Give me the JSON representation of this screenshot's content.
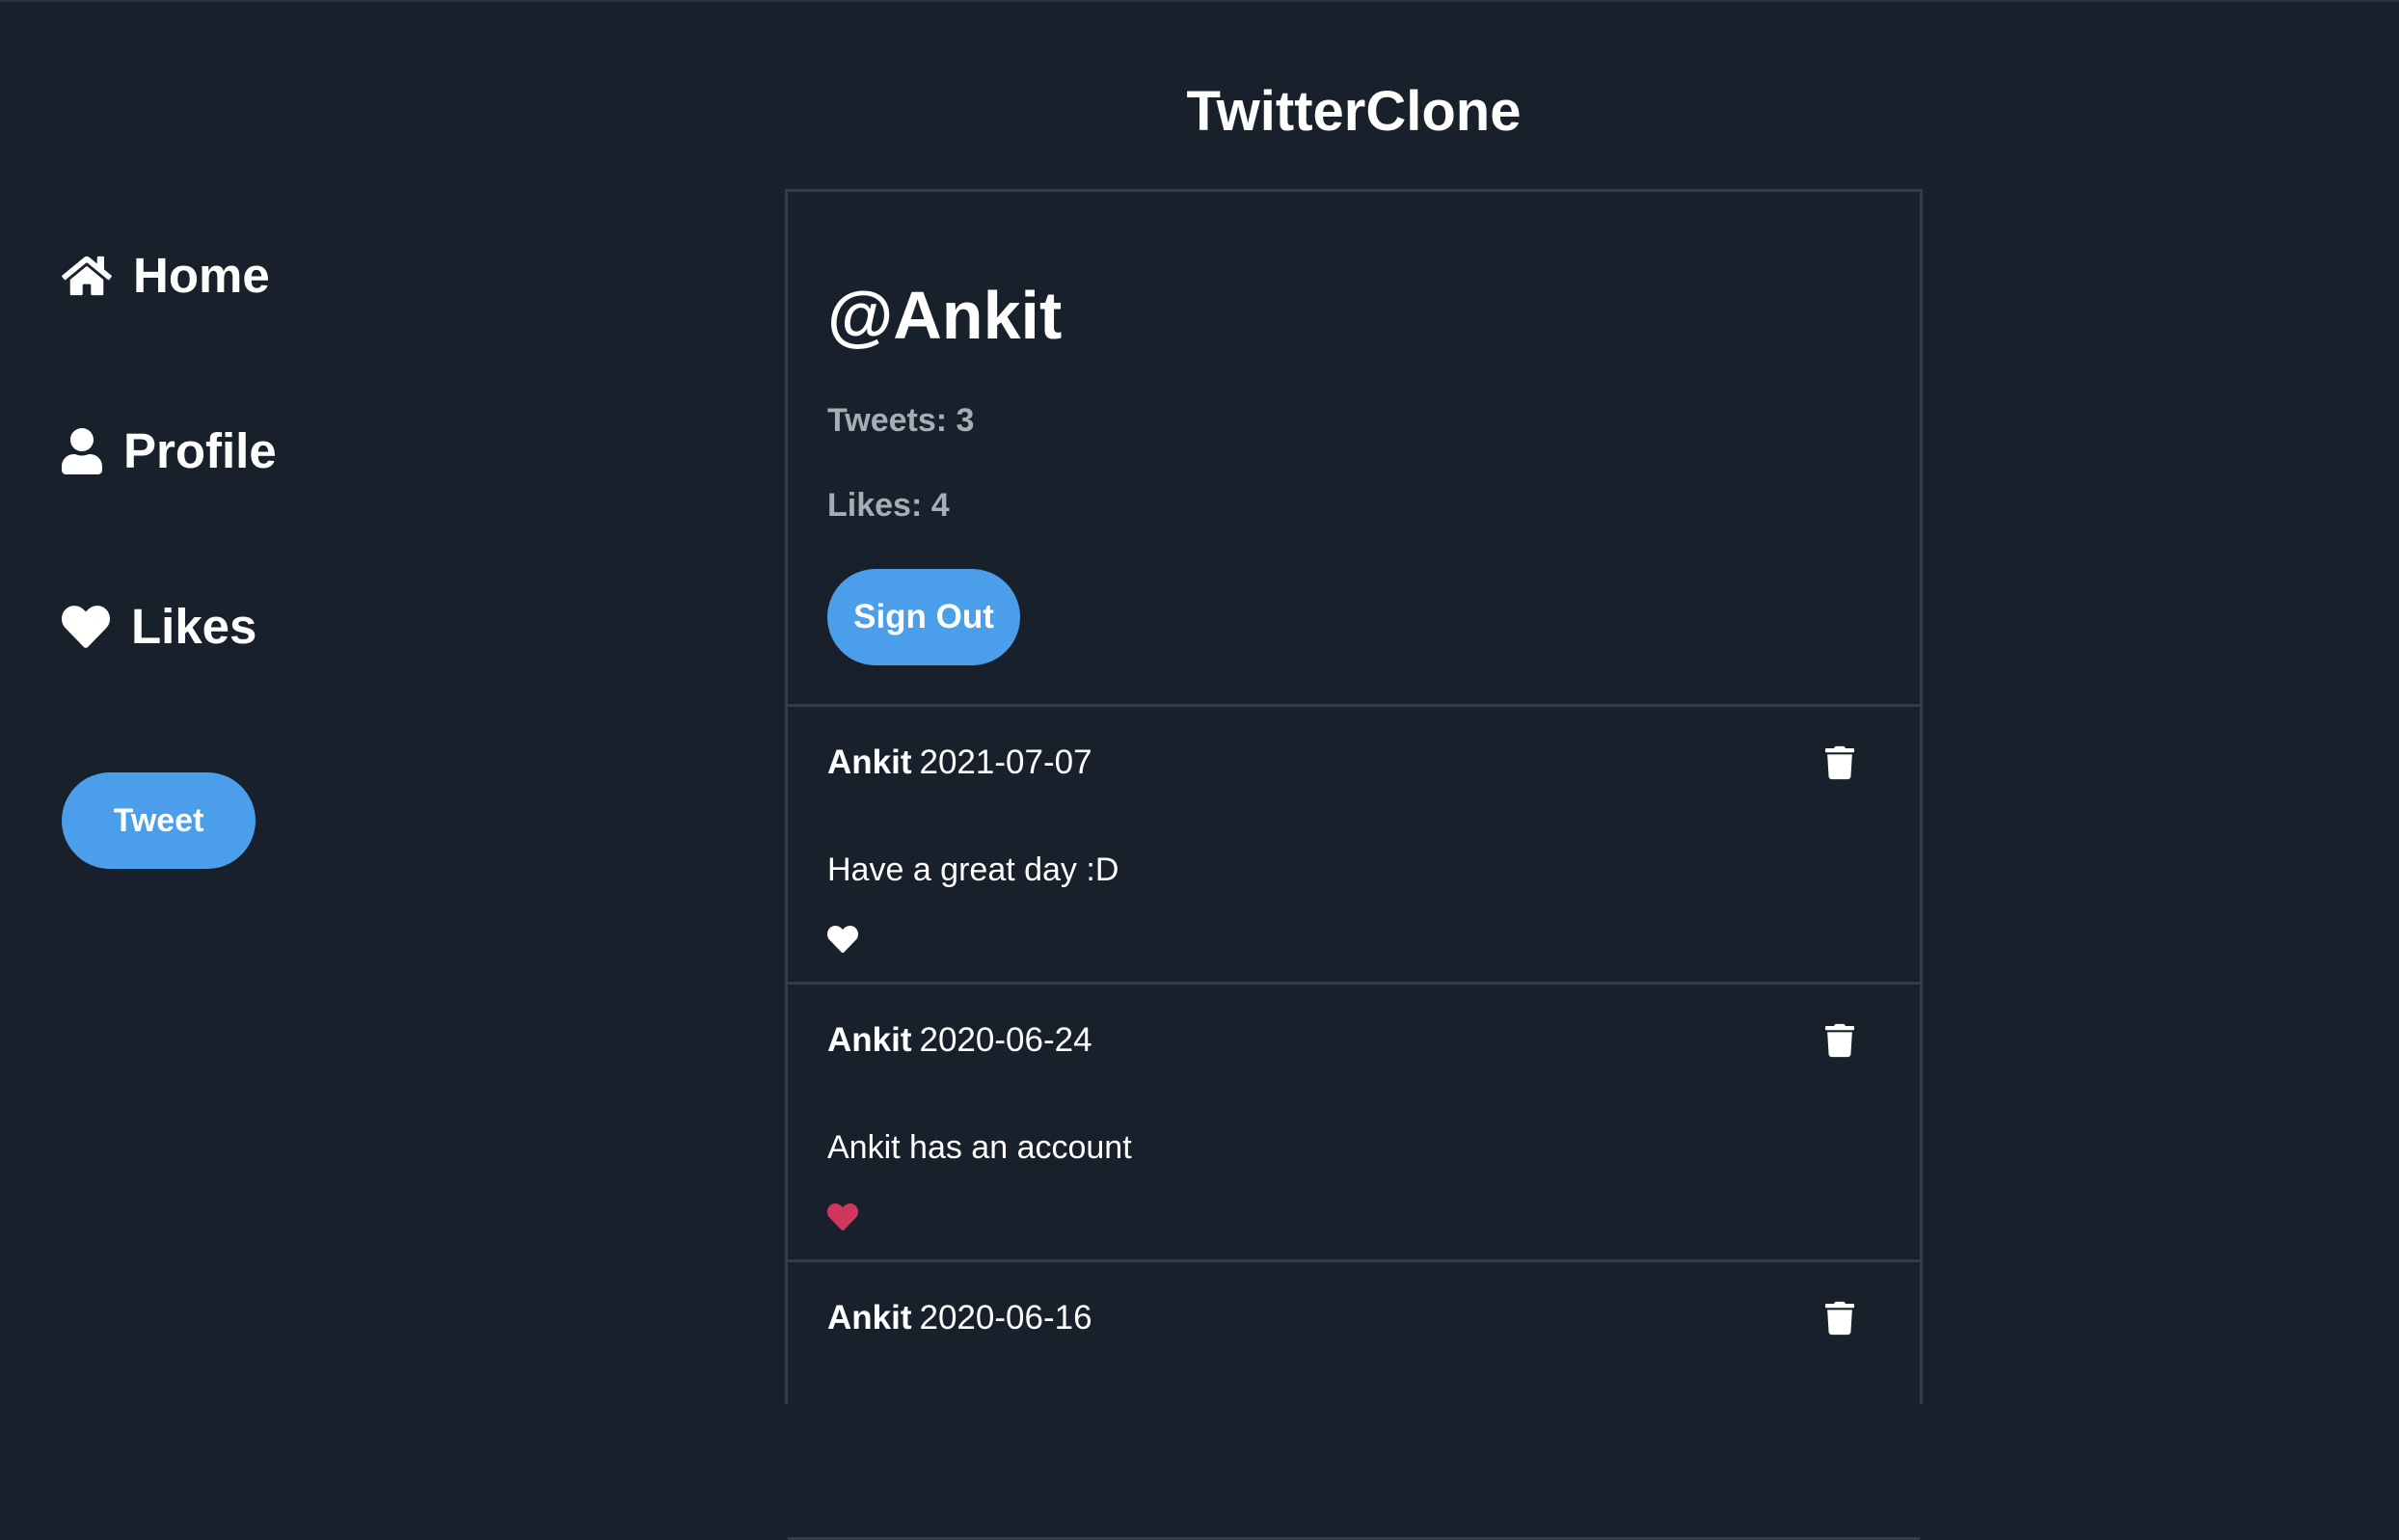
{
  "app": {
    "title": "TwitterClone"
  },
  "colors": {
    "background": "#18202b",
    "accent": "#4a9eea",
    "border": "#323d49",
    "muted_text": "#a6adb6",
    "liked_heart": "#d0375f",
    "unliked_heart": "#ffffff"
  },
  "sidebar": {
    "items": [
      {
        "label": "Home",
        "icon": "home-icon"
      },
      {
        "label": "Profile",
        "icon": "user-icon"
      },
      {
        "label": "Likes",
        "icon": "heart-icon"
      }
    ],
    "tweet_button": "Tweet"
  },
  "profile": {
    "handle": "@Ankit",
    "tweets_stat": "Tweets: 3",
    "likes_stat": "Likes: 4",
    "sign_out_label": "Sign Out"
  },
  "tweets": [
    {
      "author": "Ankit",
      "date": "2021-07-07",
      "text": "Have a great day :D",
      "liked": false,
      "icon_delete": "trash-icon",
      "icon_like": "heart-icon"
    },
    {
      "author": "Ankit",
      "date": "2020-06-24",
      "text": "Ankit has an account",
      "liked": true,
      "icon_delete": "trash-icon",
      "icon_like": "heart-icon"
    },
    {
      "author": "Ankit",
      "date": "2020-06-16",
      "text": "",
      "liked": false,
      "icon_delete": "trash-icon",
      "icon_like": "heart-icon"
    }
  ]
}
